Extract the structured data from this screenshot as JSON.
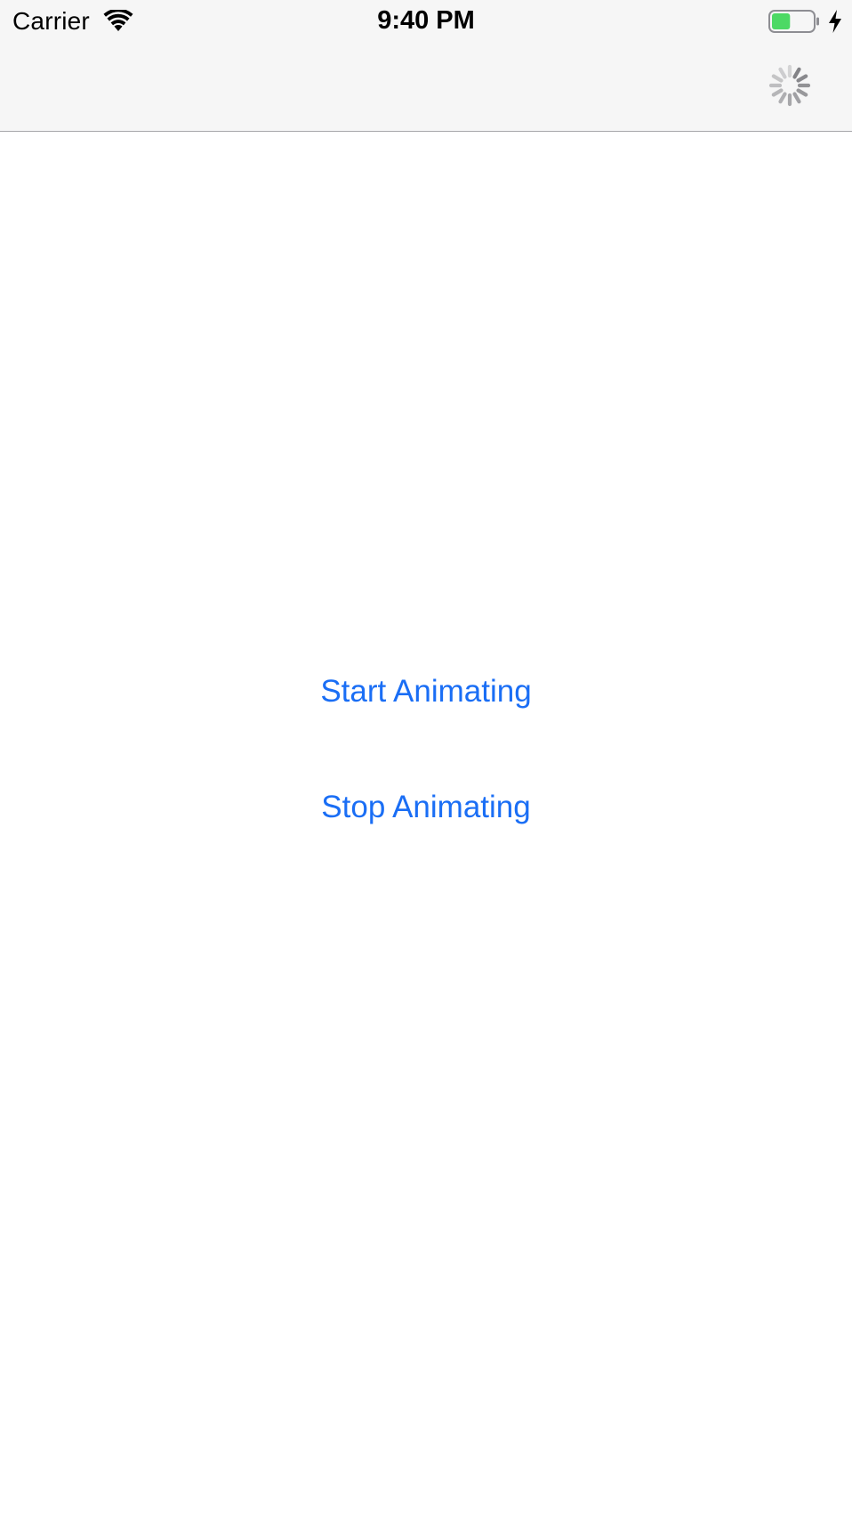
{
  "status_bar": {
    "carrier": "Carrier",
    "time": "9:40 PM",
    "wifi_icon": "wifi-icon",
    "battery_icon": "battery-charging-icon",
    "battery_level": 0.45,
    "battery_color": "#4cd964"
  },
  "nav_bar": {
    "activity_indicator": "activity-indicator-spinner",
    "animating": true
  },
  "buttons": {
    "start_label": "Start Animating",
    "stop_label": "Stop Animating"
  },
  "colors": {
    "tint": "#1a6ef5",
    "bar_background": "#f6f6f6",
    "bar_separator": "#a7a7aa"
  }
}
